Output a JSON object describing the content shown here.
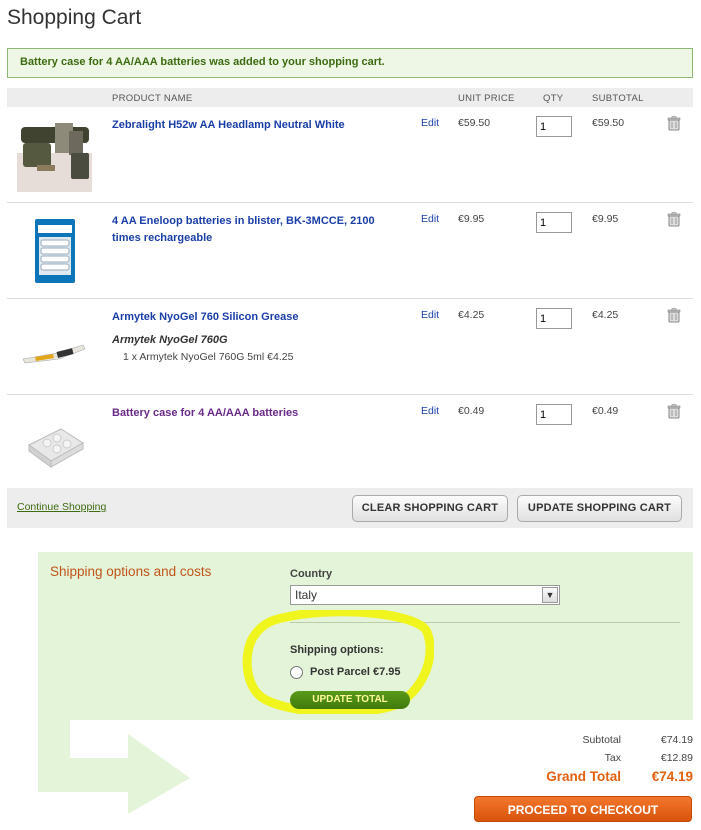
{
  "page": {
    "title": "Shopping Cart"
  },
  "message": "Battery case for 4 AA/AAA batteries was added to your shopping cart.",
  "columns": {
    "name": "PRODUCT NAME",
    "unit_price": "UNIT PRICE",
    "qty": "QTY",
    "subtotal": "SUBTOTAL"
  },
  "items": [
    {
      "name": "Zebralight H52w AA Headlamp Neutral White",
      "edit": "Edit",
      "unit_price": "€59.50",
      "qty": "1",
      "subtotal": "€59.50",
      "image_icon": "headlamp-image"
    },
    {
      "name": "4 AA Eneloop batteries in blister, BK-3MCCE, 2100 times rechargeable",
      "edit": "Edit",
      "unit_price": "€9.95",
      "qty": "1",
      "subtotal": "€9.95",
      "image_icon": "eneloop-pack-image"
    },
    {
      "name": "Armytek NyoGel 760 Silicon Grease",
      "option_name": "Armytek NyoGel 760G",
      "option_line": "1 x Armytek NyoGel 760G 5ml €4.25",
      "edit": "Edit",
      "unit_price": "€4.25",
      "qty": "1",
      "subtotal": "€4.25",
      "image_icon": "grease-tube-image"
    },
    {
      "name": "Battery case for 4 AA/AAA batteries",
      "edit": "Edit",
      "unit_price": "€0.49",
      "qty": "1",
      "subtotal": "€0.49",
      "image_icon": "battery-case-image"
    }
  ],
  "actions": {
    "continue": "Continue Shopping",
    "clear": "CLEAR SHOPPING CART",
    "update": "UPDATE SHOPPING CART"
  },
  "shipping": {
    "title": "Shipping options and costs",
    "country_label": "Country",
    "country_value": "Italy",
    "options_label": "Shipping options:",
    "option": "Post Parcel €7.95",
    "update_total": "UPDATE TOTAL"
  },
  "totals": {
    "subtotal_label": "Subtotal",
    "subtotal": "€74.19",
    "tax_label": "Tax",
    "tax": "€12.89",
    "grand_label": "Grand Total",
    "grand": "€74.19"
  },
  "checkout": "PROCEED TO CHECKOUT",
  "colors": {
    "accent_orange": "#e2600f",
    "link_blue": "#1a3ea8",
    "ship_bg": "#e4f4d8",
    "highlight": "#f0f51e"
  }
}
